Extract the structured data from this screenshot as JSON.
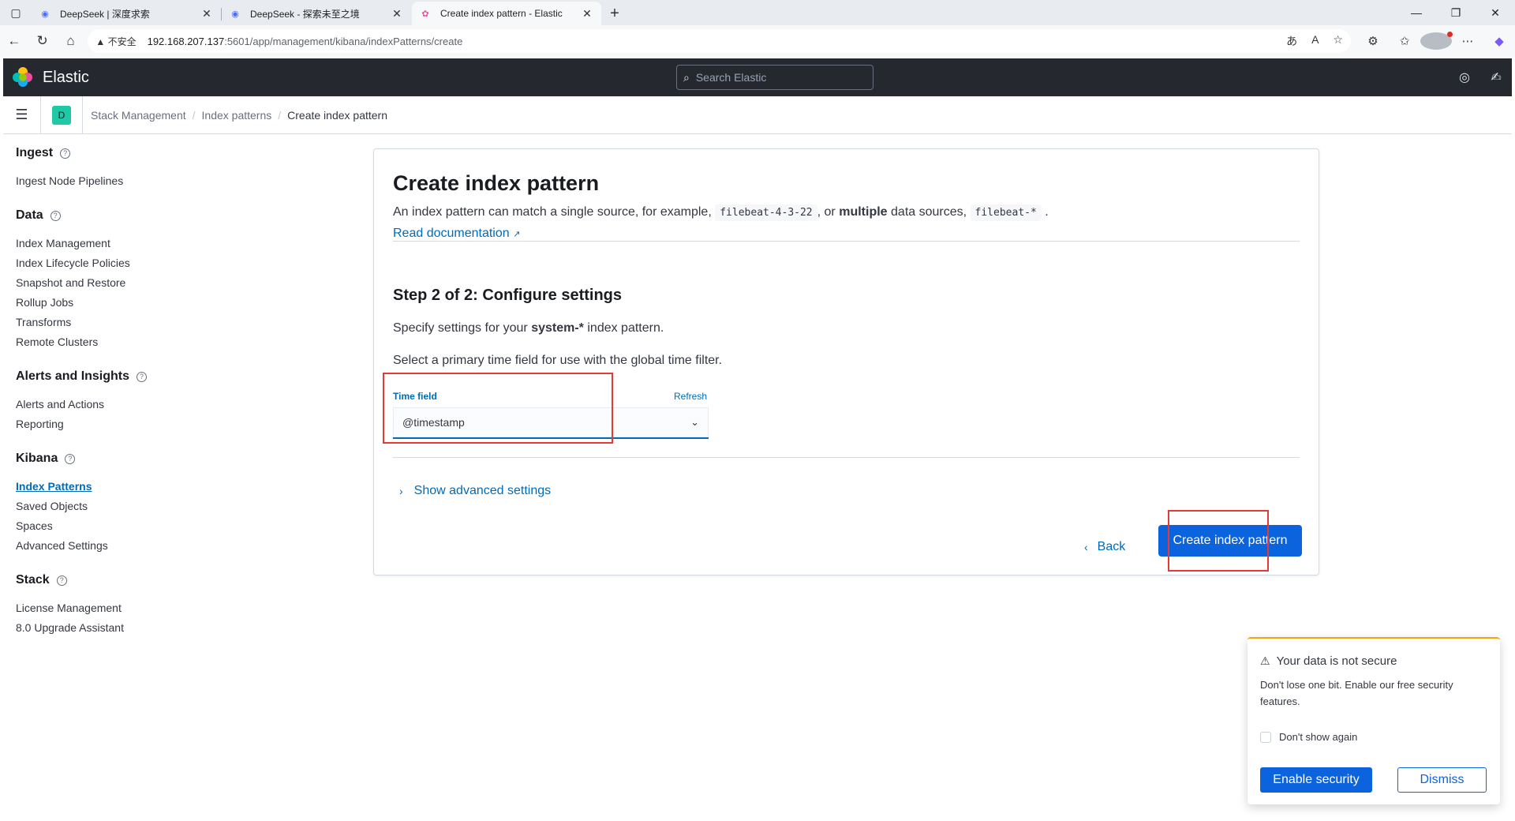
{
  "browser": {
    "tabs": [
      {
        "title": "DeepSeek | 深度求索",
        "favicon": "deepseek-icon",
        "active": false
      },
      {
        "title": "DeepSeek - 探索未至之境",
        "favicon": "deepseek-icon",
        "active": false
      },
      {
        "title": "Create index pattern - Elastic",
        "favicon": "elastic-icon",
        "active": true
      }
    ],
    "security_label": "不安全",
    "url_host": "192.168.207.137",
    "url_path": ":5601/app/management/kibana/indexPatterns/create"
  },
  "header": {
    "brand": "Elastic",
    "search_placeholder": "Search Elastic"
  },
  "breadcrumbs": {
    "space_initial": "D",
    "items": [
      "Stack Management",
      "Index patterns",
      "Create index pattern"
    ]
  },
  "sidebar": {
    "groups": [
      {
        "title": "Ingest",
        "items": [
          "Ingest Node Pipelines"
        ]
      },
      {
        "title": "Data",
        "items": [
          "Index Management",
          "Index Lifecycle Policies",
          "Snapshot and Restore",
          "Rollup Jobs",
          "Transforms",
          "Remote Clusters"
        ]
      },
      {
        "title": "Alerts and Insights",
        "items": [
          "Alerts and Actions",
          "Reporting"
        ]
      },
      {
        "title": "Kibana",
        "items": [
          "Index Patterns",
          "Saved Objects",
          "Spaces",
          "Advanced Settings"
        ]
      },
      {
        "title": "Stack",
        "items": [
          "License Management",
          "8.0 Upgrade Assistant"
        ]
      }
    ],
    "current": "Index Patterns"
  },
  "main": {
    "title": "Create index pattern",
    "desc_prefix": "An index pattern can match a single source, for example,",
    "example_single": "filebeat-4-3-22",
    "desc_or": ", or",
    "desc_multiple": "multiple",
    "desc_mid": "data sources,",
    "example_multi": "filebeat-*",
    "desc_end": ".",
    "doc_link": "Read documentation",
    "step_title": "Step 2 of 2: Configure settings",
    "spec_prefix": "Specify settings for your",
    "pattern_name": "system-*",
    "spec_suffix": "index pattern.",
    "select_text": "Select a primary time field for use with the global time filter.",
    "time_field_label": "Time field",
    "refresh_label": "Refresh",
    "time_field_value": "@timestamp",
    "advanced_label": "Show advanced settings",
    "back_label": "Back",
    "create_label": "Create index pattern"
  },
  "toast": {
    "title": "Your data is not secure",
    "body": "Don't lose one bit. Enable our free security features.",
    "checkbox_label": "Don't show again",
    "enable_label": "Enable security",
    "dismiss_label": "Dismiss"
  },
  "colors": {
    "accent": "#006bb8",
    "primary_button": "#0b64dd",
    "header_bg": "#25282f",
    "annotation_red": "#e53935",
    "toast_warning": "#f5a700"
  }
}
